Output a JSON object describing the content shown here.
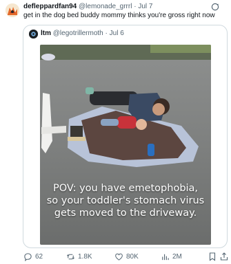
{
  "tweet": {
    "author_name": "defleppardfan94",
    "author_handle": "@lemonade_grrrl",
    "separator": "·",
    "date": "Jul 7",
    "text": "get in the dog bed buddy mommy thinks you're gross right now"
  },
  "quoted": {
    "author_name": "ltm",
    "author_handle": "@legotrillermoth",
    "separator": "·",
    "date": "Jul 6",
    "caption_lines": [
      "POV: you have emetophobia,",
      "so your toddler's stomach virus",
      "gets moved to the driveway."
    ]
  },
  "actions": {
    "replies": "62",
    "reposts": "1.8K",
    "likes": "80K",
    "views": "2M"
  },
  "icons": {
    "reply": "speech-bubble-icon",
    "repost": "repost-arrows-icon",
    "like": "heart-icon",
    "views": "bar-chart-icon",
    "bookmark": "bookmark-icon",
    "share": "share-icon",
    "header_repost": "repost-circle-icon"
  },
  "colors": {
    "muted_text": "#536471",
    "border": "#cfd9de",
    "text": "#0f1419"
  }
}
